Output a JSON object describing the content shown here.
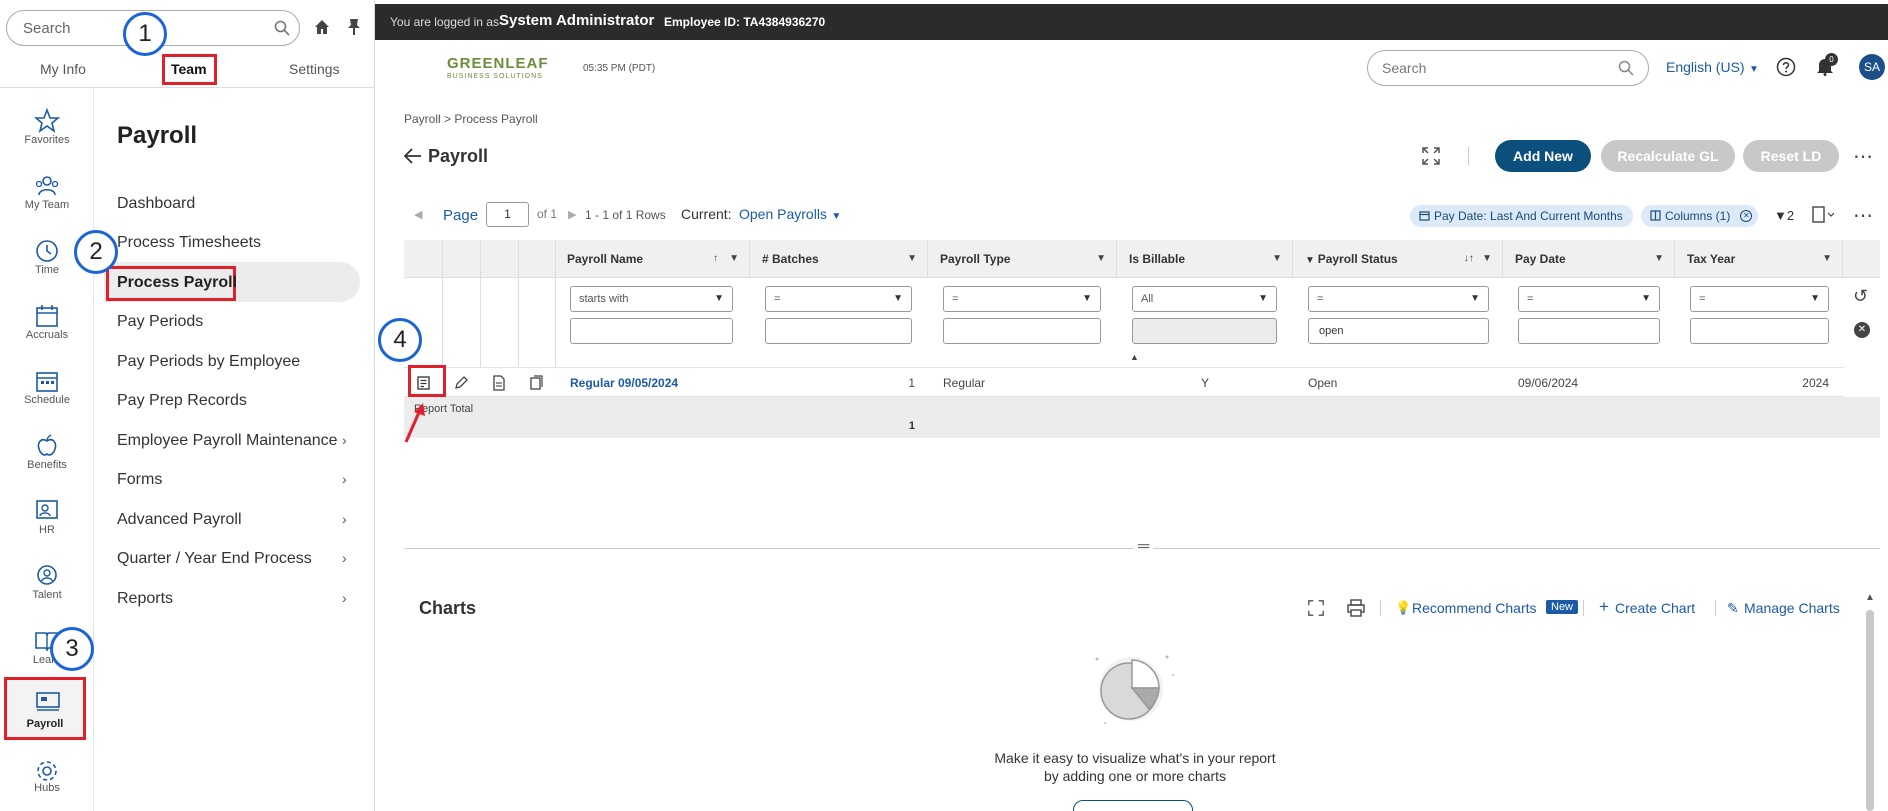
{
  "left_panel": {
    "search_placeholder": "Search",
    "tabs": [
      "My Info",
      "Team",
      "Settings"
    ],
    "rail": [
      {
        "label": "Favorites",
        "icon": "star-icon"
      },
      {
        "label": "My Team",
        "icon": "team-icon"
      },
      {
        "label": "Time",
        "icon": "clock-icon"
      },
      {
        "label": "Accruals",
        "icon": "calendar-icon"
      },
      {
        "label": "Schedule",
        "icon": "schedule-icon"
      },
      {
        "label": "Benefits",
        "icon": "apple-icon"
      },
      {
        "label": "HR",
        "icon": "hr-icon"
      },
      {
        "label": "Talent",
        "icon": "talent-icon"
      },
      {
        "label": "Learn",
        "icon": "book-icon"
      },
      {
        "label": "Payroll",
        "icon": "payroll-icon"
      },
      {
        "label": "Hubs",
        "icon": "hubs-icon"
      }
    ],
    "section_title": "Payroll",
    "menu": [
      {
        "label": "Dashboard"
      },
      {
        "label": "Process Timesheets"
      },
      {
        "label": "Process Payroll"
      },
      {
        "label": "Pay Periods"
      },
      {
        "label": "Pay Periods by Employee"
      },
      {
        "label": "Pay Prep Records"
      },
      {
        "label": "Employee Payroll Maintenance"
      },
      {
        "label": "Forms"
      },
      {
        "label": "Advanced Payroll"
      },
      {
        "label": "Quarter / Year End Process"
      },
      {
        "label": "Reports"
      }
    ]
  },
  "topbar": {
    "logged_in_as": "You are logged in as",
    "user": "System Administrator",
    "employee_id": "Employee ID: TA4384936270"
  },
  "header": {
    "time": "05:35 PM (PDT)",
    "search_placeholder": "Search",
    "language": "English (US)",
    "notification_count": "0",
    "avatar": "SA",
    "logo_text": "GREENLEAF",
    "logo_sub": "BUSINESS SOLUTIONS"
  },
  "page": {
    "breadcrumb": "Payroll  >  Process Payroll",
    "title": "Payroll",
    "buttons": {
      "add_new": "Add New",
      "recalculate": "Recalculate GL",
      "reset": "Reset LD"
    }
  },
  "toolbar": {
    "page_label": "Page",
    "page_value": "1",
    "of": "of 1",
    "rows": "1 - 1 of 1 Rows",
    "current_label": "Current:",
    "current_value": "Open Payrolls",
    "chip_paydate": "Pay Date: Last And Current Months",
    "chip_columns": "Columns (1)",
    "filter_count": "2"
  },
  "grid": {
    "columns": [
      "Payroll Name",
      "# Batches",
      "Payroll Type",
      "Is Billable",
      "Payroll Status",
      "Pay Date",
      "Tax Year"
    ],
    "filters": {
      "payroll_name_op": "starts with",
      "batches_op": "=",
      "type_op": "=",
      "billable_op": "All",
      "status_op": "=",
      "status_value": "open",
      "paydate_op": "=",
      "taxyear_op": "="
    },
    "rows": [
      {
        "name": "Regular 09/05/2024",
        "batches": "1",
        "type": "Regular",
        "billable": "Y",
        "status": "Open",
        "pay_date": "09/06/2024",
        "tax_year": "2024"
      }
    ],
    "total_label": "Report Total",
    "total_batches": "1"
  },
  "callouts": [
    "1",
    "2",
    "3",
    "4"
  ],
  "charts": {
    "title": "Charts",
    "recommend": "Recommend Charts",
    "new_badge": "New",
    "create": "Create Chart",
    "manage": "Manage Charts",
    "empty_line1": "Make it easy to visualize what's in your report",
    "empty_line2": "by adding one or more charts"
  },
  "colors": {
    "accent": "#1c5aa6",
    "primary_button": "#0b4f7c",
    "callout": "#1a63d8",
    "highlight": "#e0202a"
  }
}
